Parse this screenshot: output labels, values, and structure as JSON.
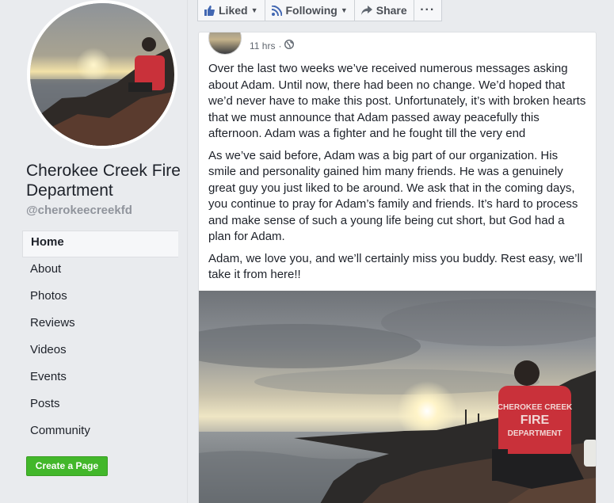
{
  "page": {
    "name": "Cherokee Creek Fire Department",
    "handle": "@cherokeecreekfd"
  },
  "nav": [
    {
      "label": "Home",
      "active": true
    },
    {
      "label": "About"
    },
    {
      "label": "Photos"
    },
    {
      "label": "Reviews"
    },
    {
      "label": "Videos"
    },
    {
      "label": "Events"
    },
    {
      "label": "Posts"
    },
    {
      "label": "Community"
    }
  ],
  "create_page_label": "Create a Page",
  "actions": {
    "liked": "Liked",
    "following": "Following",
    "share": "Share",
    "more": "···"
  },
  "post": {
    "time": "11 hrs",
    "dot": "·",
    "paragraphs": [
      "Over the last two weeks we’ve received numerous messages asking about Adam. Until now, there had been no change. We’d hoped that we’d never have to make this post. Unfortunately, it’s with broken hearts that we must announce that Adam passed away peacefully this afternoon. Adam was a fighter and he fought till the very end",
      "As we’ve said before, Adam was a big part of our organization. His smile and personality gained him many friends. He was a genuinely great guy you just liked to be around. We ask that in the coming days, you continue to pray for Adam’s family and friends. It’s hard to process and make sense of such a young life being cut short, but God had a plan for Adam.",
      "Adam, we love you, and we’ll certainly miss you buddy. Rest easy, we’ll take it from here!!"
    ]
  },
  "shirt_text": [
    "CHEROKEE CREEK",
    "FIRE",
    "DEPARTMENT"
  ],
  "colors": {
    "accent_green": "#42b72a",
    "background": "#e9ebee",
    "shirt_red": "#c9313a"
  },
  "icons": [
    "thumbs-up-icon",
    "rss-icon",
    "share-icon",
    "globe-icon"
  ]
}
